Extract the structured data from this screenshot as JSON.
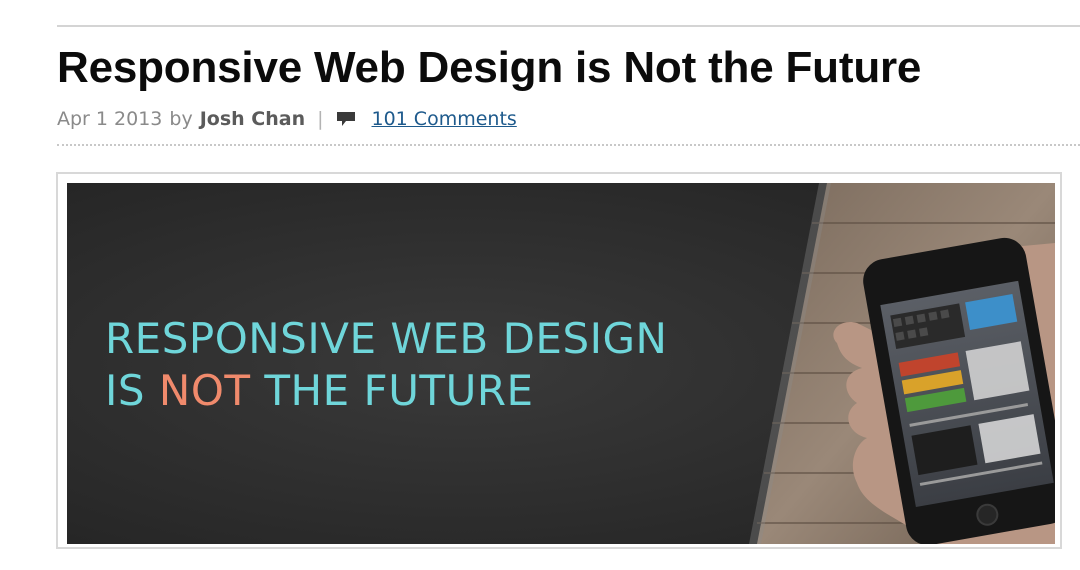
{
  "post": {
    "title": "Responsive Web Design is Not the Future",
    "date": "Apr 1 2013",
    "by_label": "by",
    "author": "Josh Chan",
    "separator": "|",
    "comments_label": "101 Comments"
  },
  "hero": {
    "line1": "RESPONSIVE WEB DESIGN",
    "line2_a": "IS",
    "line2_b": "NOT",
    "line2_c": "THE FUTURE",
    "text_color": "#6fd6da",
    "accent_color": "#f08a6c",
    "background_color": "#2e2e2e"
  },
  "icons": {
    "comment": "comment-bubble-icon"
  }
}
